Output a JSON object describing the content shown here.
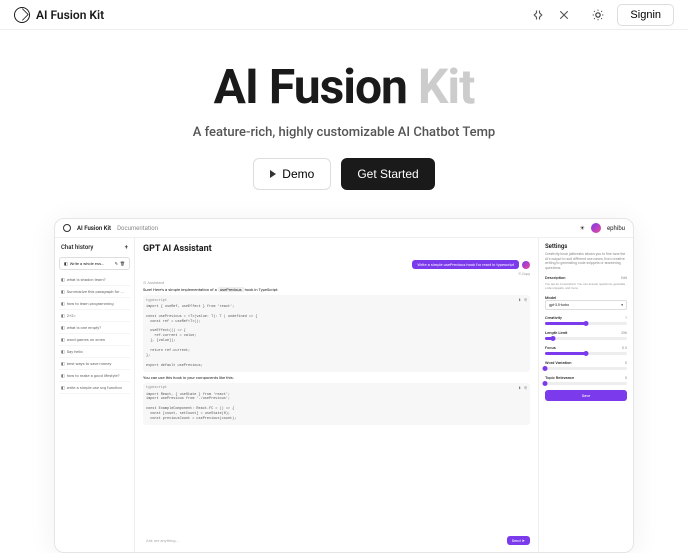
{
  "header": {
    "logo_text": "AI Fusion Kit",
    "signin": "Signin"
  },
  "hero": {
    "title_main": "AI Fusion ",
    "title_gray": "Kit",
    "subtitle": "A feature-rich, highly customizable AI Chatbot Temp",
    "demo_label": "Demo",
    "get_started_label": "Get Started"
  },
  "screenshot": {
    "header": {
      "logo_text": "AI Fusion Kit",
      "documentation": "Documentation",
      "username": "ephibu"
    },
    "sidebar": {
      "title": "Chat history",
      "new_chat": "Write a whole ess...",
      "items": [
        "what is shadcn team?",
        "Summarize this paragraph for ...",
        "how to learn programming",
        "2+2=",
        "what is one empty?",
        "word games on xmen",
        "Say hello",
        "best ways to save money",
        "how to make a good lifestyle?",
        "write a simple use svg function"
      ]
    },
    "main": {
      "title": "GPT AI Assistant",
      "user_msg": "Write a simple usePrevious hook for react in typescript",
      "copy_label": "⎘ Copy",
      "assistant_label": "⊙ Assistant",
      "assistant_intro": "Sure! Here's a simple implementation of a ",
      "assistant_hook": "usePrevious",
      "assistant_tail": " hook in TypeScript:",
      "code1_lang": "typescript",
      "code1": "import { useRef, useEffect } from 'react';\n\nconst usePrevious = <T>(value: T): T | undefined => {\n  const ref = useRef<T>();\n\n  useEffect(() => {\n    ref.current = value;\n  }, [value]);\n\n  return ref.current;\n};\n\nexport default usePrevious;",
      "between_text": "You can use this hook in your components like this:",
      "code2_lang": "typescript",
      "code2": "import React, { useState } from 'react';\nimport usePrevious from './usePrevious';\n\nconst ExampleComponent: React.FC = () => {\n  const [count, setCount] = useState(0);\n  const previousCount = usePrevious(count);",
      "input_placeholder": "Ask me anything...",
      "send_label": "Send ➤"
    },
    "settings": {
      "title": "Settings",
      "desc": "Creativity knob jailbreaks allows you to fine tune the AI's output to suit different use cases, from creative writing to generating code snippets or answering questions.",
      "description_label": "Description",
      "edit_label": "Edit",
      "description_text": "You are an AI assistant. You can answer questions, generate code snippets, and more.",
      "model_label": "Model",
      "model_value": "gpt-3.5-turbo",
      "creativity_label": "Creativity",
      "creativity_value": "1",
      "length_label": "Length Limit",
      "length_value": "256",
      "focus_label": "Focus",
      "focus_value": "0.5",
      "word_label": "Word Variation",
      "word_value": "0",
      "topic_label": "Topic Relevance",
      "topic_value": "0",
      "save_label": "Save"
    }
  }
}
